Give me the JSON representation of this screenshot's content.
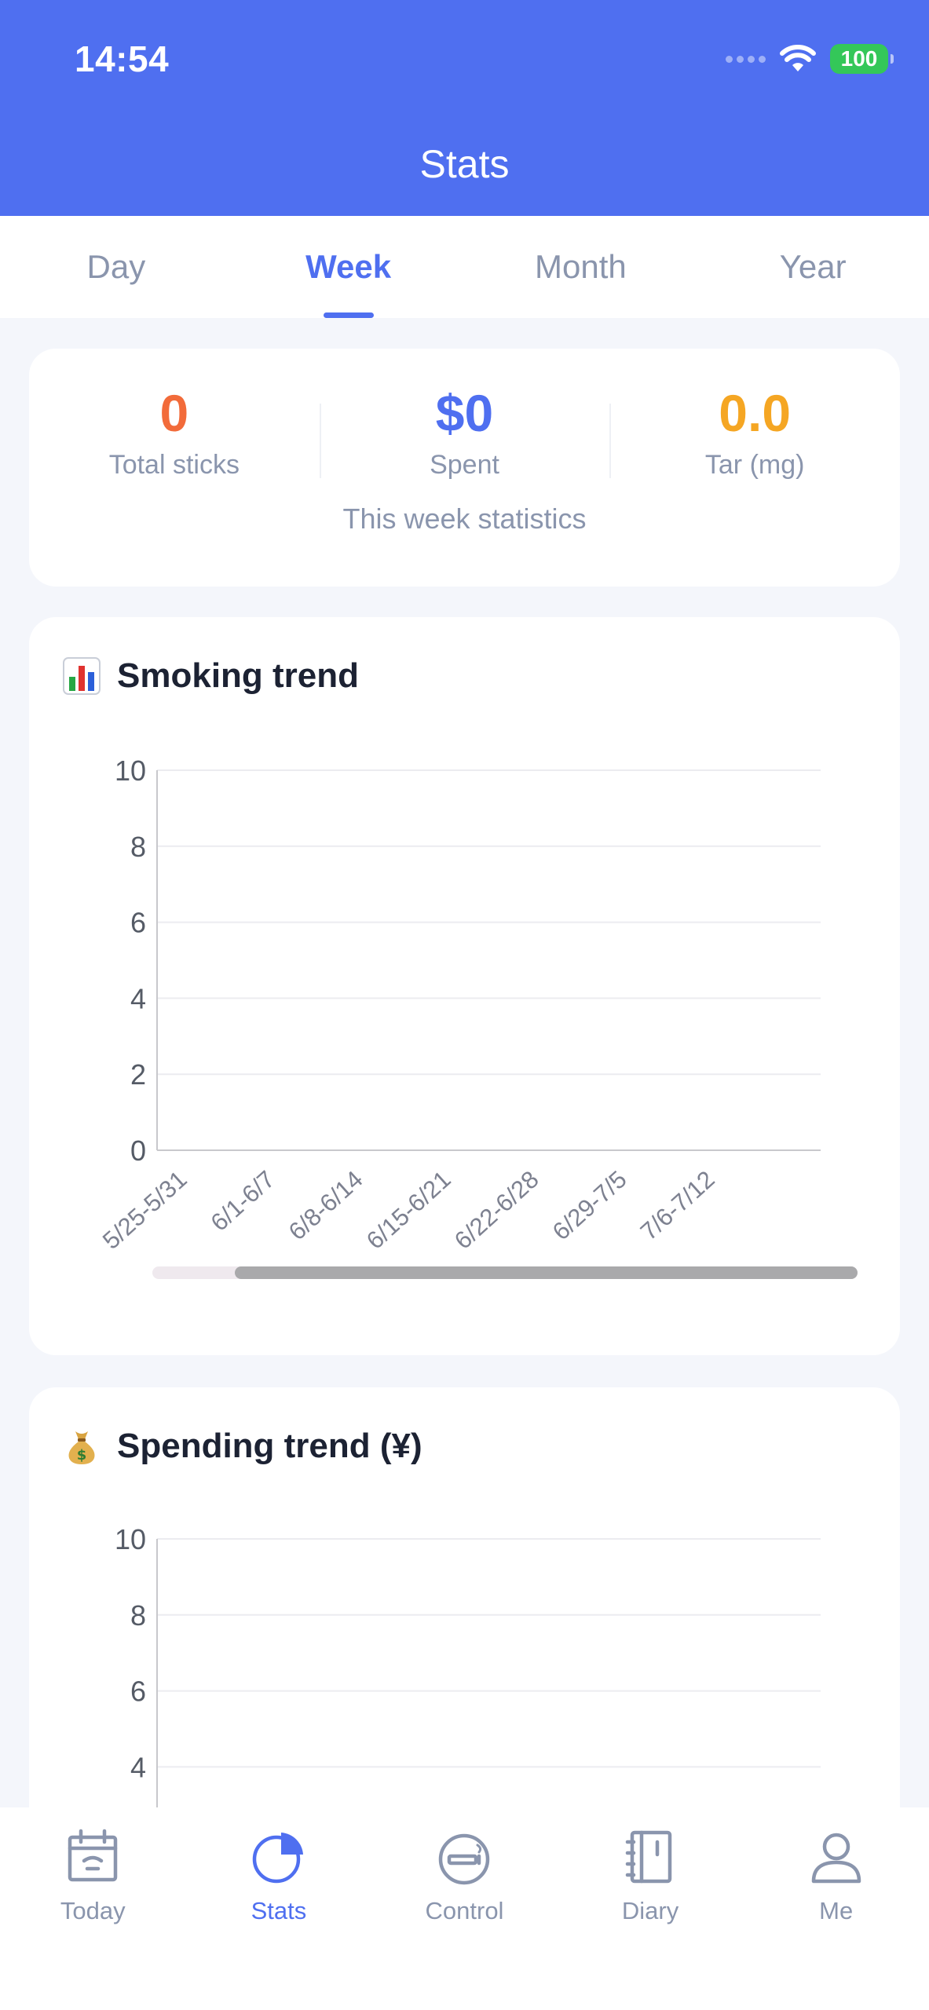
{
  "status_bar": {
    "time": "14:54",
    "battery": "100"
  },
  "header": {
    "title": "Stats"
  },
  "tabs": [
    {
      "label": "Day",
      "active": false
    },
    {
      "label": "Week",
      "active": true
    },
    {
      "label": "Month",
      "active": false
    },
    {
      "label": "Year",
      "active": false
    }
  ],
  "summary": {
    "items": [
      {
        "value": "0",
        "label": "Total sticks",
        "color": "#f26b3a"
      },
      {
        "value": "$0",
        "label": "Spent",
        "color": "#4f6ff0"
      },
      {
        "value": "0.0",
        "label": "Tar (mg)",
        "color": "#f5a623"
      }
    ],
    "caption": "This week statistics"
  },
  "smoking_trend": {
    "title": "Smoking trend",
    "icon": "bar-chart-emoji-icon"
  },
  "spending_trend": {
    "title": "Spending trend (¥)",
    "icon": "money-bag-emoji-icon"
  },
  "chart_data": [
    {
      "type": "bar",
      "title": "Smoking trend",
      "categories": [
        "5/25-5/31",
        "6/1-6/7",
        "6/8-6/14",
        "6/15-6/21",
        "6/22-6/28",
        "6/29-7/5",
        "7/6-7/12"
      ],
      "values": [
        0,
        0,
        0,
        0,
        0,
        0,
        0
      ],
      "yticks": [
        0,
        2,
        4,
        6,
        8,
        10
      ],
      "ylim": [
        0,
        10
      ],
      "grid": true,
      "scrollbar": true
    },
    {
      "type": "bar",
      "title": "Spending trend (¥)",
      "categories": [],
      "values": [],
      "yticks": [
        4,
        6,
        8,
        10
      ],
      "ylim": [
        0,
        10
      ],
      "grid": true
    }
  ],
  "bottom_nav": [
    {
      "label": "Today",
      "icon": "calendar-icon",
      "active": false
    },
    {
      "label": "Stats",
      "icon": "pie-chart-icon",
      "active": true
    },
    {
      "label": "Control",
      "icon": "no-smoking-icon",
      "active": false
    },
    {
      "label": "Diary",
      "icon": "notebook-icon",
      "active": false
    },
    {
      "label": "Me",
      "icon": "user-icon",
      "active": false
    }
  ],
  "colors": {
    "accent": "#4f6ff0",
    "muted": "#8a95ad",
    "background": "#f4f6fb"
  }
}
